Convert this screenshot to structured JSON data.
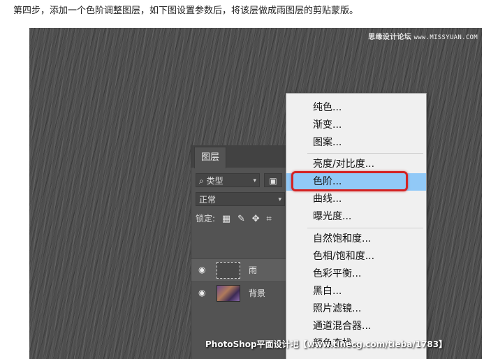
{
  "caption": "第四步，添加一个色阶调整图层，如下图设置参数后，将该层做成雨图层的剪贴蒙版。",
  "watermark_top": {
    "brand": "思缘设计论坛",
    "url": "www.MISSYUAN.COM"
  },
  "layers_panel": {
    "tab": "图层",
    "filter_kind": "类型",
    "blend_mode": "正常",
    "lock_label": "锁定:",
    "layers": [
      {
        "name": "雨",
        "selected": true
      },
      {
        "name": "背景",
        "selected": false
      }
    ]
  },
  "menu": {
    "items": [
      "纯色...",
      "渐变...",
      "图案...",
      "亮度/对比度...",
      "色阶...",
      "曲线...",
      "曝光度...",
      "自然饱和度...",
      "色相/饱和度...",
      "色彩平衡...",
      "黑白...",
      "照片滤镜...",
      "通道混合器...",
      "颜色查找..."
    ],
    "highlighted": "色阶..."
  },
  "watermark_bottom": "PhotoShop平面设计吧【www.tinecg.com/tieba/1783】",
  "colors": {
    "highlight": "#91c9f7",
    "callout": "#d42323"
  }
}
